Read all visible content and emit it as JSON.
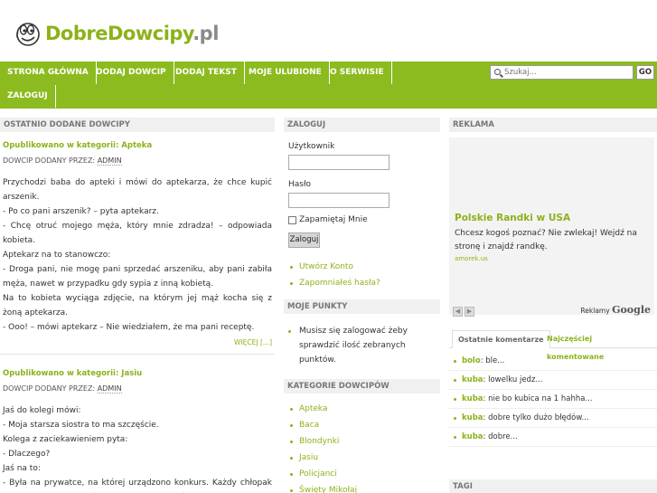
{
  "logo": {
    "main": "DobreDowcipy",
    "suffix": ".pl"
  },
  "nav": {
    "items": [
      "STRONA GŁÓWNA",
      "DODAJ DOWCIP",
      "DODAJ TEKST",
      "MOJE ULUBIONE",
      "O SERWISIE",
      "ZALOGUJ"
    ],
    "search_placeholder": "Szukaj...",
    "go": "GO"
  },
  "left": {
    "heading": "OSTATNIO DODANE DOWCIPY",
    "posts": [
      {
        "category": "Opublikowano w kategorii: Apteka",
        "by_prefix": "DOWCIP DODANY PRZEZ: ",
        "author": "ADMIN",
        "lines": [
          "Przychodzi baba do apteki i mówi do aptekarza, że chce kupić arszenik.",
          "- Po co pani arszenik? – pyta aptekarz.",
          "- Chcę otruć mojego męża, który mnie zdradza! – odpowiada kobieta.",
          "Aptekarz na to stanowczo:",
          "- Droga pani, nie mogę pani sprzedać arszeniku, aby pani zabiła męża, nawet w przypadku gdy sypia z inną kobietą.",
          "Na to kobieta wyciąga zdjęcie, na którym jej mąż kocha się z żoną aptekarza.",
          "- Ooo! – mówi aptekarz – Nie wiedziałem, że ma pani receptę."
        ],
        "more": "WIĘCEJ [...]"
      },
      {
        "category": "Opublikowano w kategorii: Jasiu",
        "by_prefix": "DOWCIP DODANY PRZEZ: ",
        "author": "ADMIN",
        "lines": [
          "Jaś do kolegi mówi:",
          "- Moja starsza siostra to ma szczęście.",
          "Kolega z zaciekawieniem pyta:",
          "- Dlaczego?",
          "Jaś na to:",
          "- Była na prywatce, na której urządzono konkurs. Każdy chłopak musiał albo pocałować dziewczynę, albo dać jej czekoladę."
        ]
      }
    ]
  },
  "mid": {
    "login_heading": "ZALOGUJ",
    "user_label": "Użytkownik",
    "pass_label": "Hasło",
    "remember": "Zapamiętaj Mnie",
    "login_btn": "Zaloguj",
    "links": [
      "Utwórz Konto",
      "Zapomniałeś hasła?"
    ],
    "points_heading": "MOJE PUNKTY",
    "points_text": "Musisz się zalogować żeby sprawdzić ilość zebranych punktów.",
    "cats_heading": "KATEGORIE DOWCIPÓW",
    "categories": [
      "Apteka",
      "Baca",
      "Blondynki",
      "Jasiu",
      "Policjanci",
      "Święty Mikołaj"
    ]
  },
  "right": {
    "ad_heading": "REKLAMA",
    "ad_title": "Polskie Randki w USA",
    "ad_text": "Chcesz kogoś poznać? Nie zwlekaj! Wejdź na stronę i znajdź randkę.",
    "ad_url": "amorek.us",
    "ad_google_prefix": "Reklamy",
    "ad_google": "Google",
    "tabs": [
      "Ostatnie komentarze",
      "Najczęściej komentowane"
    ],
    "comments": [
      {
        "who": "bolo",
        "text": ": ble..."
      },
      {
        "who": "kuba",
        "text": ": lowelku jedz..."
      },
      {
        "who": "kuba",
        "text": ": nie bo kubica na 1 hahha..."
      },
      {
        "who": "kuba",
        "text": ": dobre tylko dużo błędów..."
      },
      {
        "who": "kuba",
        "text": ": dobre..."
      }
    ],
    "tags_heading": "TAGI"
  }
}
